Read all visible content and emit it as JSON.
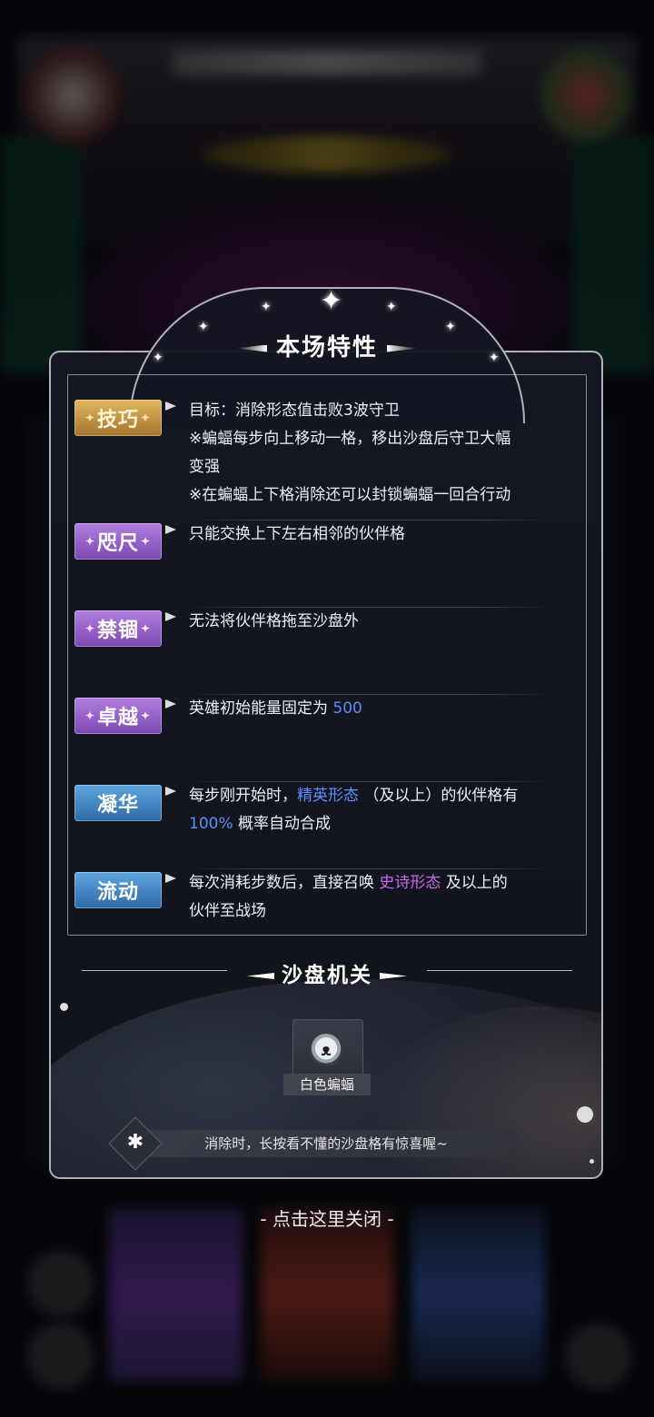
{
  "panel": {
    "title": "本场特性"
  },
  "traits": [
    {
      "badge": "技巧",
      "style": "gold",
      "lines": [
        "目标：消除形态值击败3波守卫",
        "※蝙蝠每步向上移动一格，移出沙盘后守卫大幅",
        "变强",
        "※在蝙蝠上下格消除还可以封锁蝙蝠一回合行动"
      ]
    },
    {
      "badge": "咫尺",
      "style": "purple",
      "text": "只能交换上下左右相邻的伙伴格"
    },
    {
      "badge": "禁锢",
      "style": "purple",
      "text": "无法将伙伴格拖至沙盘外"
    },
    {
      "badge": "卓越",
      "style": "purple",
      "text_before": "英雄初始能量固定为 ",
      "value": "500"
    },
    {
      "badge": "凝华",
      "style": "blue",
      "part1": "每步刚开始时，",
      "form": "精英形态",
      "part2": " （及以上）的伙伴格有",
      "percent": "100%",
      "part3": " 概率自动合成"
    },
    {
      "badge": "流动",
      "style": "blue",
      "part1": "每次消耗步数后，直接召唤 ",
      "form": "史诗形态",
      "part2": " 及以上的",
      "line2": "伙伴至战场"
    }
  ],
  "mechanism": {
    "title": "沙盘机关",
    "item_label": "白色蝙蝠",
    "item_icon": "white-bat-icon"
  },
  "tip": {
    "text": "消除时，长按看不懂的沙盘格有惊喜喔~",
    "icon": "star-icon"
  },
  "close_hint": "- 点击这里关闭 -",
  "colors": {
    "highlight_blue": "#5f8cff",
    "highlight_purple": "#c26ce6",
    "badge_gold": "#c6973f",
    "badge_purple": "#9a63cb",
    "badge_blue": "#4688c4"
  }
}
